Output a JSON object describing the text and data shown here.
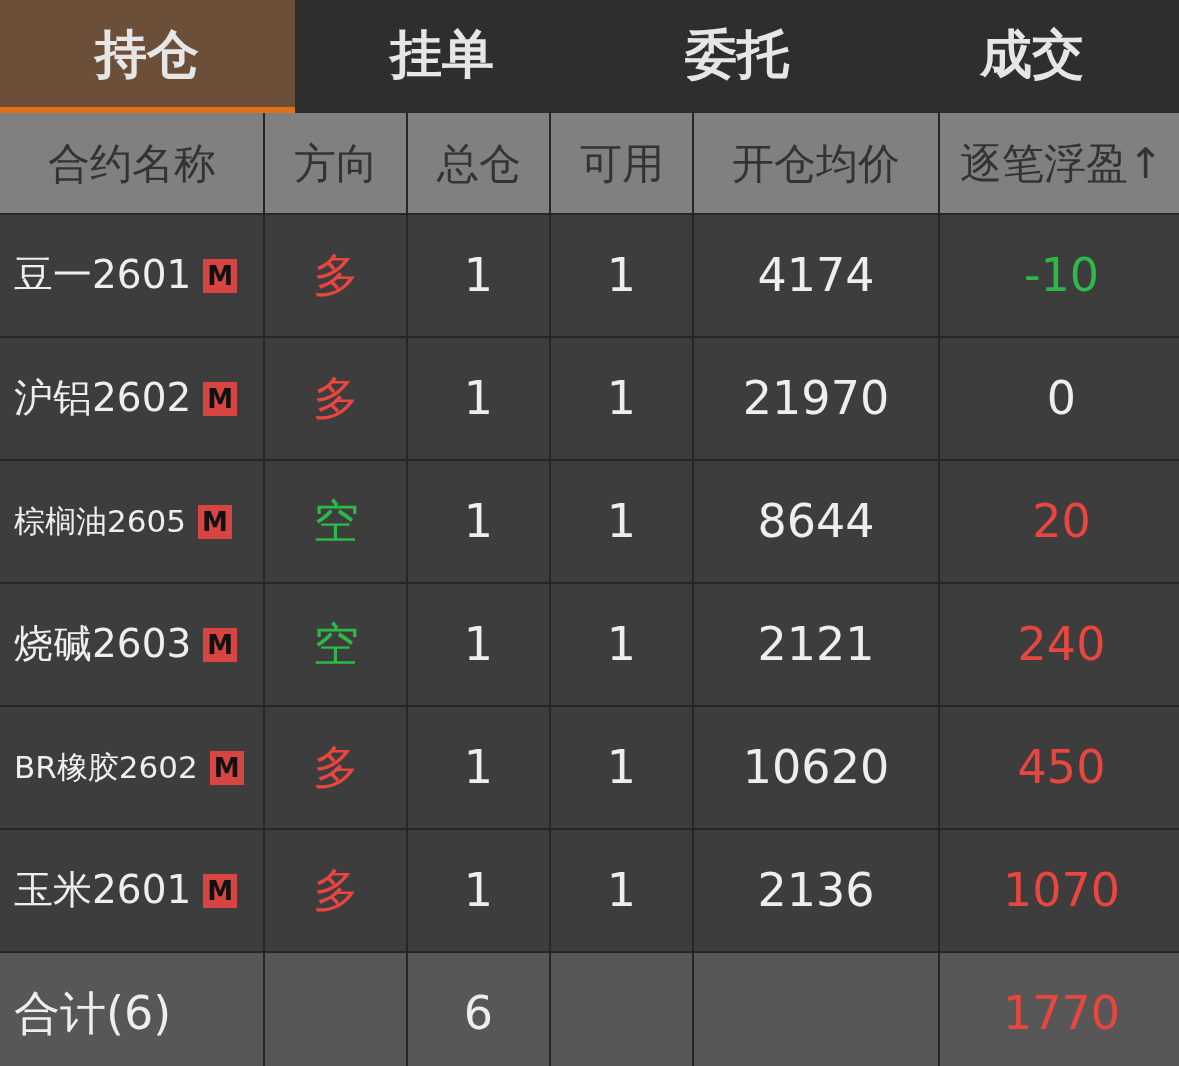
{
  "tabs": [
    {
      "label": "持仓",
      "selected": true
    },
    {
      "label": "挂单",
      "selected": false
    },
    {
      "label": "委托",
      "selected": false
    },
    {
      "label": "成交",
      "selected": false
    }
  ],
  "columns": [
    "合约名称",
    "方向",
    "总仓",
    "可用",
    "开仓均价",
    "逐笔浮盈↑"
  ],
  "rows": [
    {
      "name": "豆一2601",
      "badge": "M",
      "direction": {
        "text": "多",
        "color": "#e8463f"
      },
      "total": "1",
      "available": "1",
      "avg_open_price": "4174",
      "pnl": {
        "text": "-10",
        "color": "#2eb84a"
      }
    },
    {
      "name": "沪铝2602",
      "badge": "M",
      "direction": {
        "text": "多",
        "color": "#e8463f"
      },
      "total": "1",
      "available": "1",
      "avg_open_price": "21970",
      "pnl": {
        "text": "0",
        "color": "#eeeeee"
      }
    },
    {
      "name": "棕榈油2605",
      "badge": "M",
      "direction": {
        "text": "空",
        "color": "#2eb84a"
      },
      "total": "1",
      "available": "1",
      "avg_open_price": "8644",
      "pnl": {
        "text": "20",
        "color": "#e8463f"
      }
    },
    {
      "name": "烧碱2603",
      "badge": "M",
      "direction": {
        "text": "空",
        "color": "#2eb84a"
      },
      "total": "1",
      "available": "1",
      "avg_open_price": "2121",
      "pnl": {
        "text": "240",
        "color": "#e8463f"
      }
    },
    {
      "name": "BR橡胶2602",
      "badge": "M",
      "direction": {
        "text": "多",
        "color": "#e8463f"
      },
      "total": "1",
      "available": "1",
      "avg_open_price": "10620",
      "pnl": {
        "text": "450",
        "color": "#e8463f"
      }
    },
    {
      "name": "玉米2601",
      "badge": "M",
      "direction": {
        "text": "多",
        "color": "#e8463f"
      },
      "total": "1",
      "available": "1",
      "avg_open_price": "2136",
      "pnl": {
        "text": "1070",
        "color": "#e8463f"
      }
    }
  ],
  "total": {
    "label": "合计(6)",
    "total": "6",
    "pnl": {
      "text": "1770",
      "color": "#e8463f"
    }
  }
}
